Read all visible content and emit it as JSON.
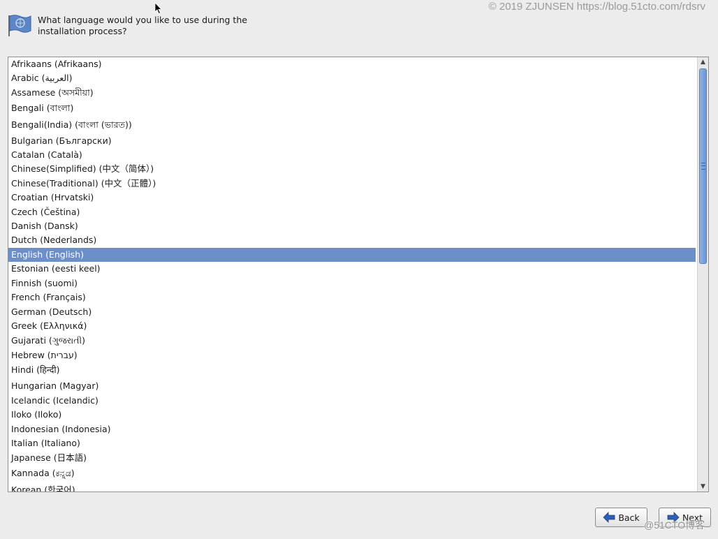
{
  "header": {
    "question": "What language would you like to use during the installation process?"
  },
  "watermark": {
    "top": "© 2019 ZJUNSEN https://blog.51cto.com/rdsrv",
    "bottom": "@51CTO博客"
  },
  "language_list": {
    "selected": "English (English)",
    "items": [
      "Afrikaans (Afrikaans)",
      "Arabic (العربية)",
      "Assamese (অসমীয়া)",
      "Bengali (বাংলা)",
      "Bengali(India) (বাংলা (ভারত))",
      "Bulgarian (Български)",
      "Catalan (Català)",
      "Chinese(Simplified) (中文（简体）)",
      "Chinese(Traditional) (中文（正體）)",
      "Croatian (Hrvatski)",
      "Czech (Čeština)",
      "Danish (Dansk)",
      "Dutch (Nederlands)",
      "English (English)",
      "Estonian (eesti keel)",
      "Finnish (suomi)",
      "French (Français)",
      "German (Deutsch)",
      "Greek (Ελληνικά)",
      "Gujarati (ગુજરાતી)",
      "Hebrew (עברית)",
      "Hindi (हिन्दी)",
      "Hungarian (Magyar)",
      "Icelandic (Icelandic)",
      "Iloko (Iloko)",
      "Indonesian (Indonesia)",
      "Italian (Italiano)",
      "Japanese (日本語)",
      "Kannada (ಕನ್ನಡ)",
      "Korean (한국어)"
    ]
  },
  "scrollbar": {
    "up_icon": "arrow-up-icon",
    "down_icon": "arrow-down-icon",
    "up_glyph": "▲",
    "down_glyph": "▼"
  },
  "buttons": {
    "back_label": "Back",
    "next_label": "Next"
  },
  "colors": {
    "selection": "#6b8fc9",
    "accent_arrow": "#2f5fb3"
  }
}
